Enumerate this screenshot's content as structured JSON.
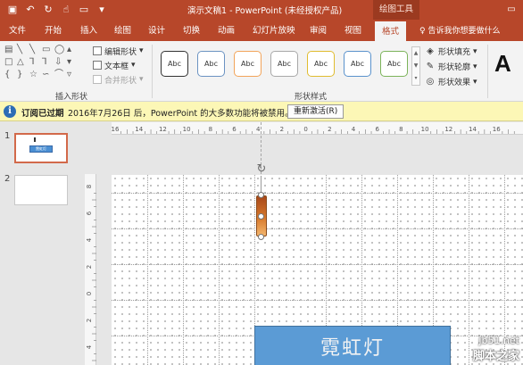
{
  "titlebar": {
    "title": "演示文稿1 - PowerPoint (未经授权产品)",
    "context_tab": "绘图工具",
    "qat_icons": [
      "save-icon",
      "undo-icon",
      "redo-icon",
      "touch-mode-icon",
      "present-icon",
      "customize-icon"
    ]
  },
  "tabs": [
    "文件",
    "开始",
    "插入",
    "绘图",
    "设计",
    "切换",
    "动画",
    "幻灯片放映",
    "审阅",
    "视图",
    "格式"
  ],
  "active_tab": "格式",
  "tell_me": "告诉我你想要做什么",
  "ribbon": {
    "insert_shapes": {
      "label": "插入形状",
      "edit_shape": "编辑形状",
      "text_box": "文本框",
      "merge_shapes": "合并形状"
    },
    "shape_styles": {
      "label": "形状样式",
      "presets": [
        {
          "label": "Abc",
          "border": "#333333"
        },
        {
          "label": "Abc",
          "border": "#6b93c2"
        },
        {
          "label": "Abc",
          "border": "#f2a45a"
        },
        {
          "label": "Abc",
          "border": "#a8a8a8"
        },
        {
          "label": "Abc",
          "border": "#e0bc2f"
        },
        {
          "label": "Abc",
          "border": "#5a92cc"
        },
        {
          "label": "Abc",
          "border": "#7cb35a"
        }
      ],
      "fill": "形状填充",
      "outline": "形状轮廓",
      "effects": "形状效果"
    },
    "wordart_letter": "A"
  },
  "message_bar": {
    "title": "订阅已过期",
    "text": "2016年7月26日 后，PowerPoint 的大多数功能将被禁用。",
    "button": "重新激活(R)"
  },
  "thumbnails": [
    {
      "number": "1",
      "mini_text": "霓虹灯"
    },
    {
      "number": "2"
    }
  ],
  "ruler": {
    "h_labels": [
      "16",
      "14",
      "12",
      "10",
      "8",
      "6",
      "4",
      "2",
      "0",
      "2",
      "4",
      "6",
      "8",
      "10",
      "12",
      "14",
      "16"
    ],
    "v_labels": [
      "8",
      "6",
      "4",
      "2",
      "0",
      "2",
      "4"
    ]
  },
  "slide": {
    "banner_text": "霓虹灯",
    "banner_color": "#5b9bd5"
  },
  "watermark": {
    "line1": "jb51.net",
    "line2": "脚本之家"
  }
}
